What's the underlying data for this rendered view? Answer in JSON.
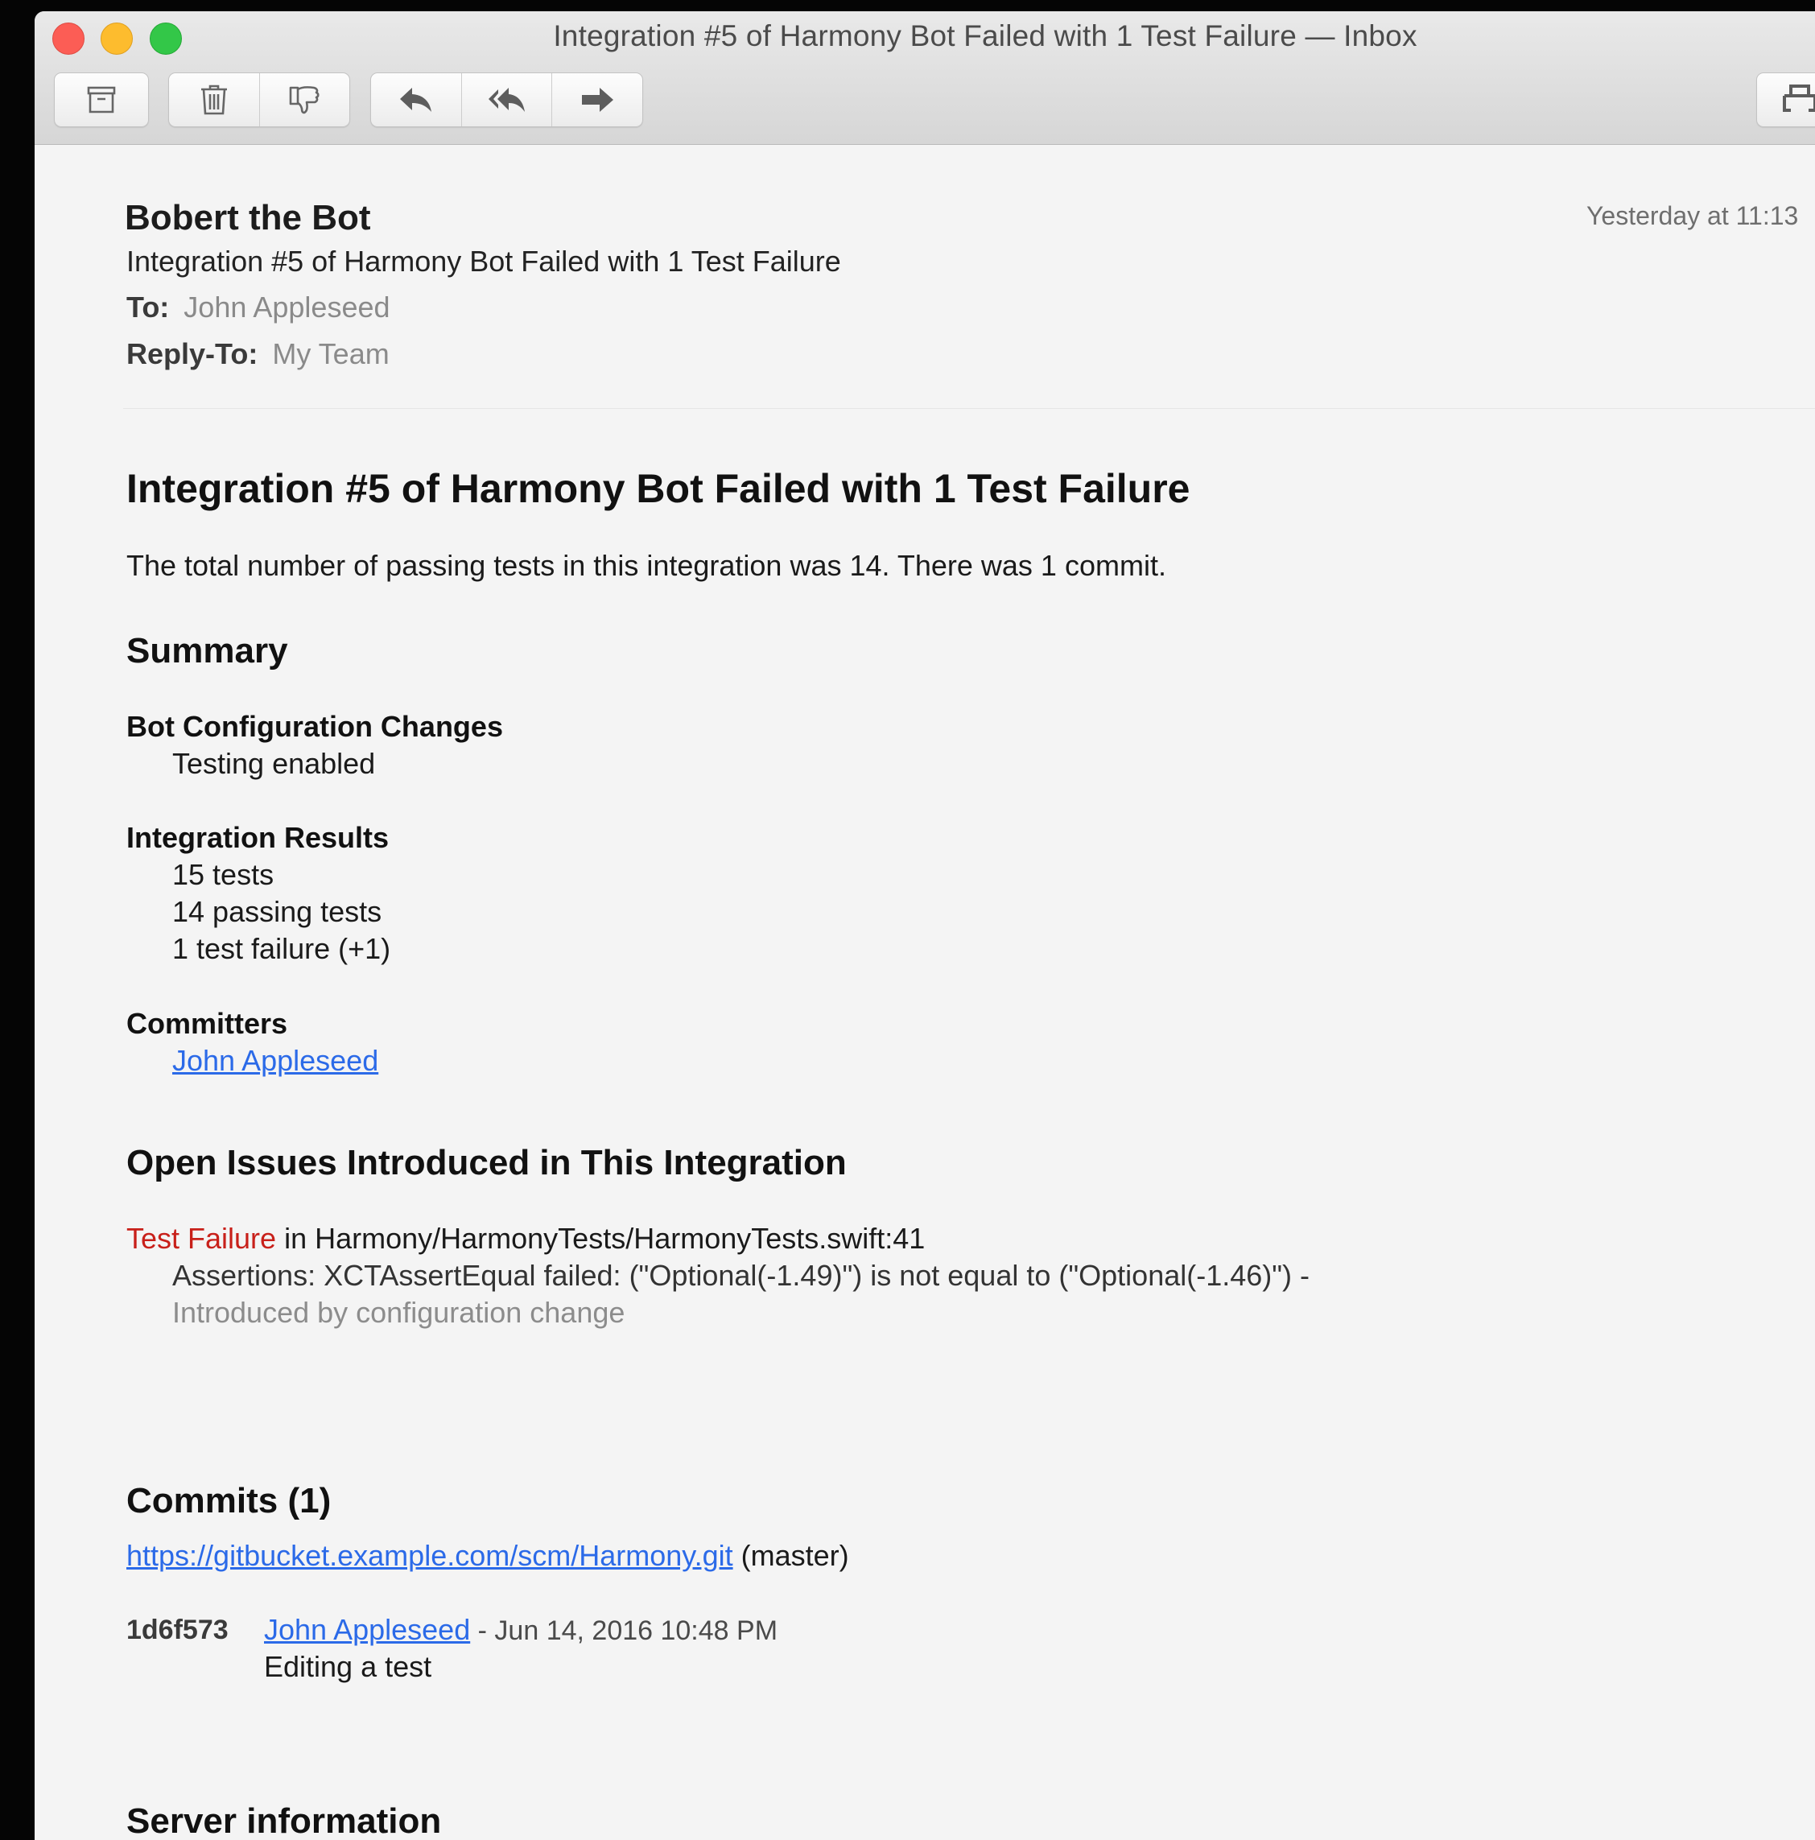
{
  "window": {
    "title": "Integration #5 of Harmony Bot Failed with 1 Test Failure — Inbox"
  },
  "toolbar": {
    "archive_icon": "archive-box-icon",
    "trash_icon": "trash-icon",
    "junk_icon": "thumbs-down-icon",
    "reply_icon": "reply-arrow-icon",
    "reply_all_icon": "reply-all-arrow-icon",
    "forward_icon": "forward-arrow-icon",
    "print_icon": "printer-icon"
  },
  "message": {
    "sender": "Bobert the Bot",
    "date": "Yesterday at 11:13",
    "subject": "Integration #5 of Harmony Bot Failed with 1 Test Failure",
    "to_label": "To:",
    "to_value": "John Appleseed",
    "reply_to_label": "Reply-To:",
    "reply_to_value": "My Team"
  },
  "body": {
    "heading": "Integration #5 of Harmony Bot Failed with 1 Test Failure",
    "intro": "The total number of passing tests in this integration was 14. There was 1 commit.",
    "summary": {
      "heading": "Summary",
      "config_heading": "Bot Configuration Changes",
      "config_items": [
        "Testing enabled"
      ],
      "results_heading": "Integration Results",
      "results_items": [
        "15 tests",
        "14 passing tests",
        "1 test failure (+1)"
      ],
      "committers_heading": "Committers",
      "committers": [
        "John Appleseed"
      ]
    },
    "issues": {
      "heading": "Open Issues Introduced in This Integration",
      "failure_label": "Test Failure",
      "failure_location": " in Harmony/HarmonyTests/HarmonyTests.swift:41",
      "assertion": "Assertions: XCTAssertEqual failed: (\"Optional(-1.49)\") is not equal to (\"Optional(-1.46)\") -",
      "note": "Introduced by configuration change"
    },
    "commits": {
      "heading": "Commits (1)",
      "repo_url": "https://gitbucket.example.com/scm/Harmony.git",
      "branch": " (master)",
      "hash": "1d6f573",
      "author": "John Appleseed",
      "date": " - Jun 14, 2016 10:48 PM",
      "message": "Editing a test"
    },
    "server": {
      "heading": "Server information"
    }
  },
  "colors": {
    "link": "#2b6ae8",
    "failure": "#c8201a",
    "close": "#fc5d55",
    "minimize": "#fdbc2e",
    "maximize": "#33c748"
  }
}
